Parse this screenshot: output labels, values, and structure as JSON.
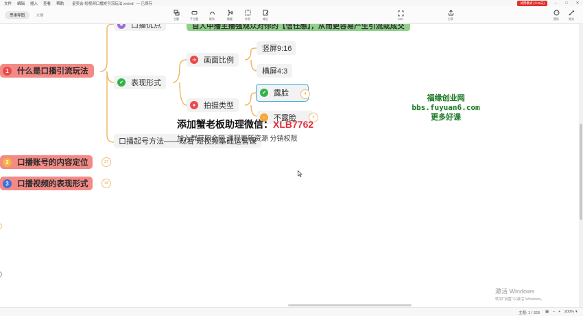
{
  "menu": {
    "items": [
      "文件",
      "编辑",
      "插入",
      "查看",
      "帮助"
    ],
    "file_title": "星奕会-短视频口播矩引流玩法.xmind",
    "save_state": "— 已保存",
    "trial_badge": "试用模式 (①19天)"
  },
  "toolbar": {
    "view_tabs": [
      "思维导图",
      "大纲"
    ],
    "tools": [
      {
        "label": "主题",
        "icon": "topic-icon"
      },
      {
        "label": "子主题",
        "icon": "subtopic-icon"
      },
      {
        "label": "联系",
        "icon": "relationship-icon"
      },
      {
        "label": "概要",
        "icon": "summary-icon"
      },
      {
        "label": "外框",
        "icon": "boundary-icon"
      },
      {
        "label": "笔记",
        "icon": "note-icon"
      }
    ],
    "zen_label": "ZEN",
    "share_label": "分享",
    "right_tools": [
      {
        "label": "图标",
        "icon": "sticker-icon"
      },
      {
        "label": "格式",
        "icon": "format-icon"
      }
    ]
  },
  "mindmap": {
    "root_nodes": [
      {
        "num": "1",
        "label": "什么是口播引流玩法",
        "color": "#e94b4b"
      },
      {
        "num": "2",
        "label": "口播账号的内容定位",
        "color": "#f4b43a",
        "badge": "27"
      },
      {
        "num": "3",
        "label": "口播视频的表现形式",
        "color": "#3d6fdc",
        "badge": "34"
      }
    ],
    "top_node": {
      "label": "口播优点"
    },
    "green_banner": "自人中播主播强观众对你的【信任感】，从而更容易产生引流或成交",
    "expression": {
      "label": "表现形式"
    },
    "ratio": {
      "label": "画面比例",
      "children": [
        "竖屏9:16",
        "横屏4:3"
      ]
    },
    "shoot_type": {
      "label": "拍摄类型",
      "children": [
        {
          "label": "露脸",
          "badge": "4"
        },
        {
          "label": "不露脸",
          "badge": "4"
        }
      ]
    },
    "opening_method": "口播起号方法——观看 短视频基础运营课"
  },
  "watermarks": {
    "wechat_prefix": "添加蟹老板助理微信：",
    "wechat_code": "XLB7762",
    "wechat_sub": "加入群获取全网    课程更新资源    分销权限",
    "fuyuan_lines": [
      "福缘创业网",
      "bbs.fuyuan6.com",
      "更多好课"
    ]
  },
  "status": {
    "topic_count": "主题: 1 / 328",
    "zoom": "200%"
  },
  "windows_activation": {
    "title": "激活 Windows",
    "subtitle": "转到\"设置\"以激活 Windows。"
  }
}
